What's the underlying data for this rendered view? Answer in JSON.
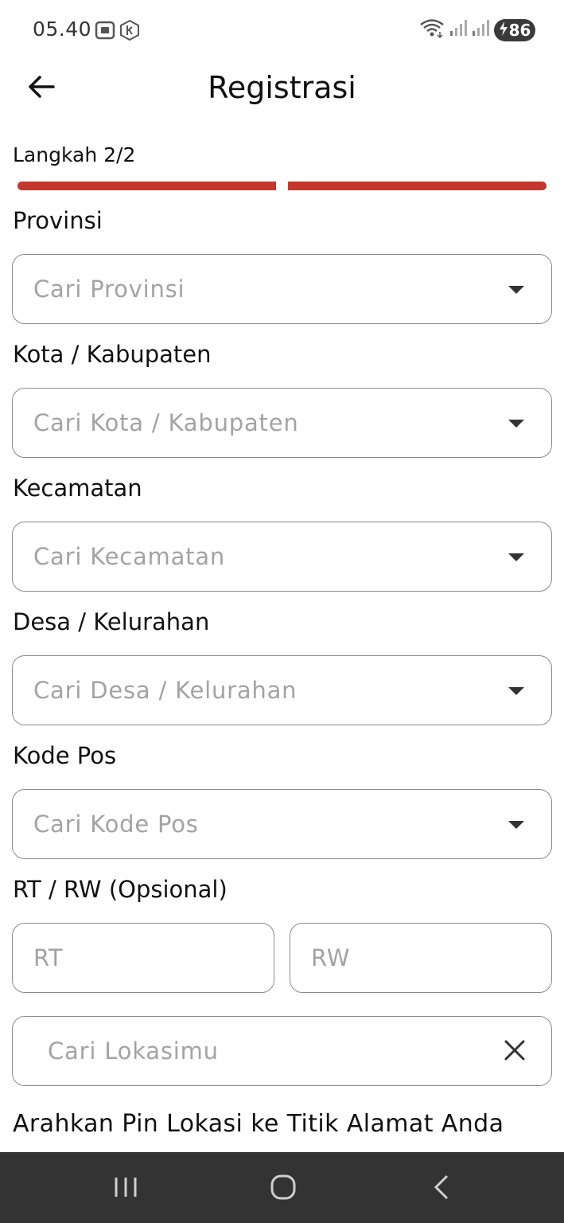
{
  "status_bar": {
    "time": "05.40",
    "battery_level": "86",
    "icons": [
      "screenshot-icon",
      "k-app-icon",
      "wifi-icon",
      "signal-icon",
      "signal-icon",
      "battery-charging-icon"
    ]
  },
  "app_bar": {
    "title": "Registrasi",
    "back_icon": "arrow-left-icon"
  },
  "step": {
    "label": "Langkah 2/2",
    "current": 2,
    "total": 2,
    "color": "#c4372c"
  },
  "fields": {
    "provinsi": {
      "label": "Provinsi",
      "placeholder": "Cari Provinsi"
    },
    "kota": {
      "label": "Kota / Kabupaten",
      "placeholder": "Cari Kota / Kabupaten"
    },
    "kecamatan": {
      "label": "Kecamatan",
      "placeholder": "Cari Kecamatan"
    },
    "desa": {
      "label": "Desa / Kelurahan",
      "placeholder": "Cari Desa / Kelurahan"
    },
    "kode_pos": {
      "label": "Kode Pos",
      "placeholder": "Cari Kode Pos"
    },
    "rt_rw": {
      "label": "RT / RW (Opsional)",
      "rt_placeholder": "RT",
      "rw_placeholder": "RW"
    },
    "lokasi": {
      "placeholder": "Cari Lokasimu"
    }
  },
  "map_hint": "Arahkan Pin Lokasi ke Titik Alamat Anda",
  "colors": {
    "accent": "#c4372c",
    "placeholder": "#a3a3a3",
    "nav_bar": "#333333"
  }
}
